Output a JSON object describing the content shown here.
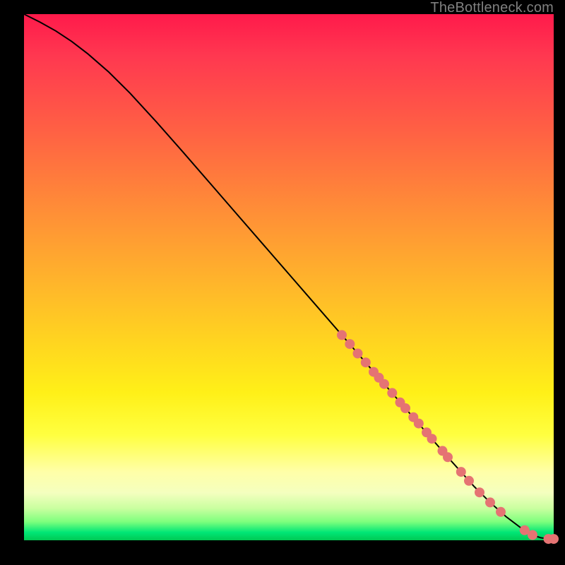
{
  "attribution": "TheBottleneck.com",
  "chart_data": {
    "type": "line",
    "title": "",
    "xlabel": "",
    "ylabel": "",
    "xlim": [
      0,
      100
    ],
    "ylim": [
      0,
      100
    ],
    "series": [
      {
        "name": "curve",
        "x": [
          0,
          3,
          6,
          9,
          12,
          16,
          20,
          25,
          30,
          35,
          40,
          45,
          50,
          55,
          60,
          65,
          70,
          75,
          80,
          85,
          88,
          91,
          94,
          96,
          97.5,
          99,
          100
        ],
        "y": [
          100,
          98.5,
          96.8,
          94.8,
          92.5,
          89,
          85,
          79.5,
          73.8,
          68,
          62.2,
          56.4,
          50.6,
          44.8,
          39,
          33.2,
          27.4,
          21.6,
          15.8,
          10.2,
          7.2,
          4.5,
          2.2,
          1.0,
          0.5,
          0.25,
          0.25
        ]
      }
    ],
    "points": {
      "name": "markers",
      "color": "#e57373",
      "x": [
        60,
        61.5,
        63,
        64.5,
        66,
        67,
        68,
        69.5,
        71,
        72,
        73.5,
        74.5,
        76,
        77,
        79,
        80,
        82.5,
        84,
        86,
        88,
        90,
        94.5,
        96,
        99,
        100
      ],
      "y": [
        39.0,
        37.3,
        35.5,
        33.8,
        32.0,
        30.9,
        29.7,
        28.0,
        26.2,
        25.1,
        23.4,
        22.2,
        20.5,
        19.3,
        17.0,
        15.8,
        13.0,
        11.3,
        9.1,
        7.2,
        5.4,
        1.9,
        1.0,
        0.25,
        0.25
      ]
    }
  }
}
